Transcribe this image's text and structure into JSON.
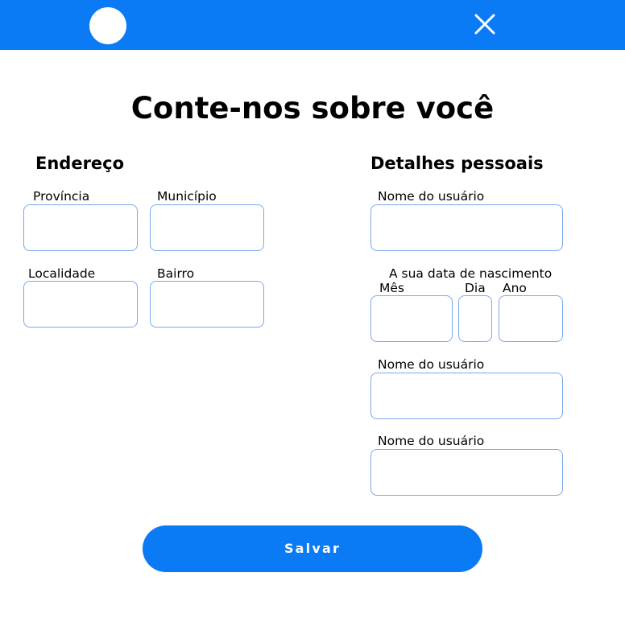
{
  "header": {
    "background_color": "#0a7af5",
    "avatar_icon": "avatar-circle",
    "close_icon": "close-x-icon"
  },
  "page_title": "Conte-nos sobre você",
  "address": {
    "title": "Endereço",
    "province_label": "Província",
    "municipality_label": "Município",
    "locality_label": "Localidade",
    "neighborhood_label": "Bairro"
  },
  "personal": {
    "title": "Detalhes pessoais",
    "username_label_1": "Nome do usuário",
    "birthdate_label": "A sua data de nascimento",
    "month_label": "Mês",
    "day_label": "Dia",
    "year_label": "Ano",
    "username_label_2": "Nome do usuário",
    "username_label_3": "Nome do usuário"
  },
  "save_label": "Salvar",
  "colors": {
    "accent": "#0a7af5",
    "field_border": "#7aa7ee"
  }
}
